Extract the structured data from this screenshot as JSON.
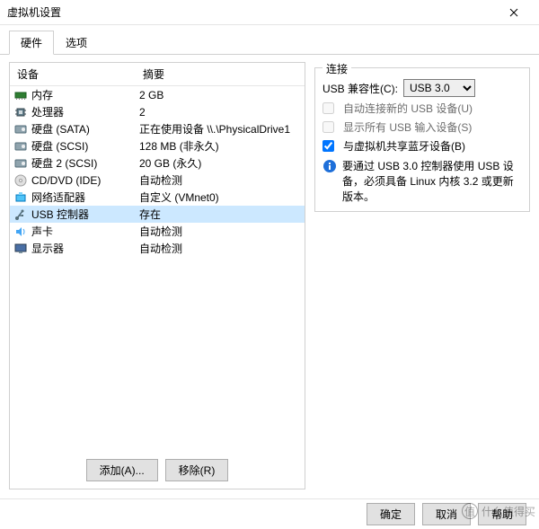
{
  "window": {
    "title": "虚拟机设置"
  },
  "tabs": {
    "hardware": "硬件",
    "options": "选项"
  },
  "headers": {
    "device": "设备",
    "summary": "摘要"
  },
  "devices": [
    {
      "icon": "memory",
      "name": "内存",
      "summary": "2 GB"
    },
    {
      "icon": "cpu",
      "name": "处理器",
      "summary": "2"
    },
    {
      "icon": "disk",
      "name": "硬盘 (SATA)",
      "summary": "正在使用设备 \\\\.\\PhysicalDrive1"
    },
    {
      "icon": "disk",
      "name": "硬盘 (SCSI)",
      "summary": "128 MB (非永久)"
    },
    {
      "icon": "disk",
      "name": "硬盘 2 (SCSI)",
      "summary": "20 GB (永久)"
    },
    {
      "icon": "cd",
      "name": "CD/DVD (IDE)",
      "summary": "自动检测"
    },
    {
      "icon": "net",
      "name": "网络适配器",
      "summary": "自定义 (VMnet0)"
    },
    {
      "icon": "usb",
      "name": "USB 控制器",
      "summary": "存在"
    },
    {
      "icon": "sound",
      "name": "声卡",
      "summary": "自动检测"
    },
    {
      "icon": "display",
      "name": "显示器",
      "summary": "自动检测"
    }
  ],
  "selectedIndex": 7,
  "buttons": {
    "add": "添加(A)...",
    "remove": "移除(R)",
    "ok": "确定",
    "cancel": "取消",
    "help": "帮助"
  },
  "connections": {
    "groupTitle": "连接",
    "compatLabel": "USB 兼容性(C):",
    "compatValue": "USB 3.0",
    "autoConnect": "自动连接新的 USB 设备(U)",
    "showAll": "显示所有 USB 输入设备(S)",
    "shareBt": "与虚拟机共享蓝牙设备(B)",
    "infoText": "要通过 USB 3.0 控制器使用 USB 设备，必须具备 Linux 内核 3.2 或更新版本。"
  },
  "watermark": "什么值得买"
}
